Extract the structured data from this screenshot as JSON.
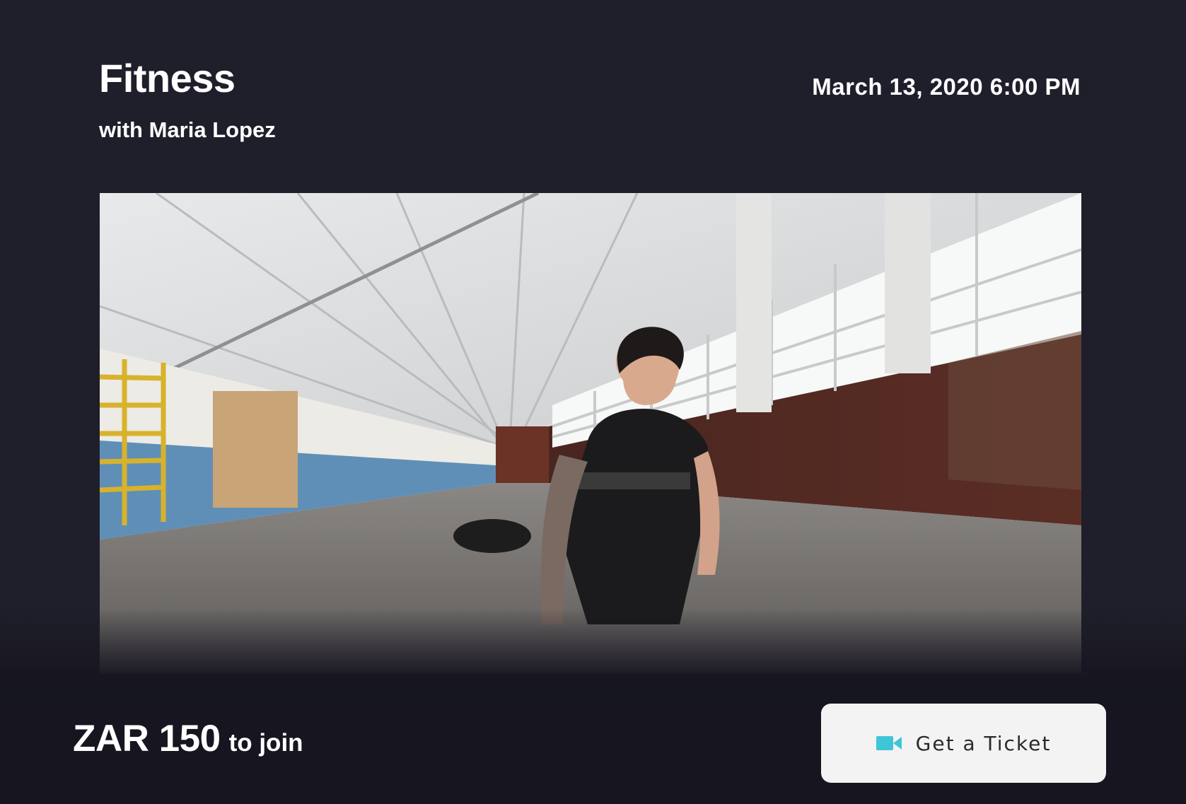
{
  "event": {
    "title": "Fitness",
    "host": "with Maria Lopez",
    "datetime": "March 13, 2020 6:00 PM"
  },
  "hero": {
    "subject": "gym-interior-athlete"
  },
  "footer": {
    "price": "ZAR 150",
    "price_suffix": "to join",
    "ticket_button_label": "Get a Ticket",
    "ticket_button_icon": "video-camera-icon"
  },
  "colors": {
    "background": "#1f1f2b",
    "button_bg": "#f3f3f3",
    "icon_accent": "#3fc6d6"
  }
}
